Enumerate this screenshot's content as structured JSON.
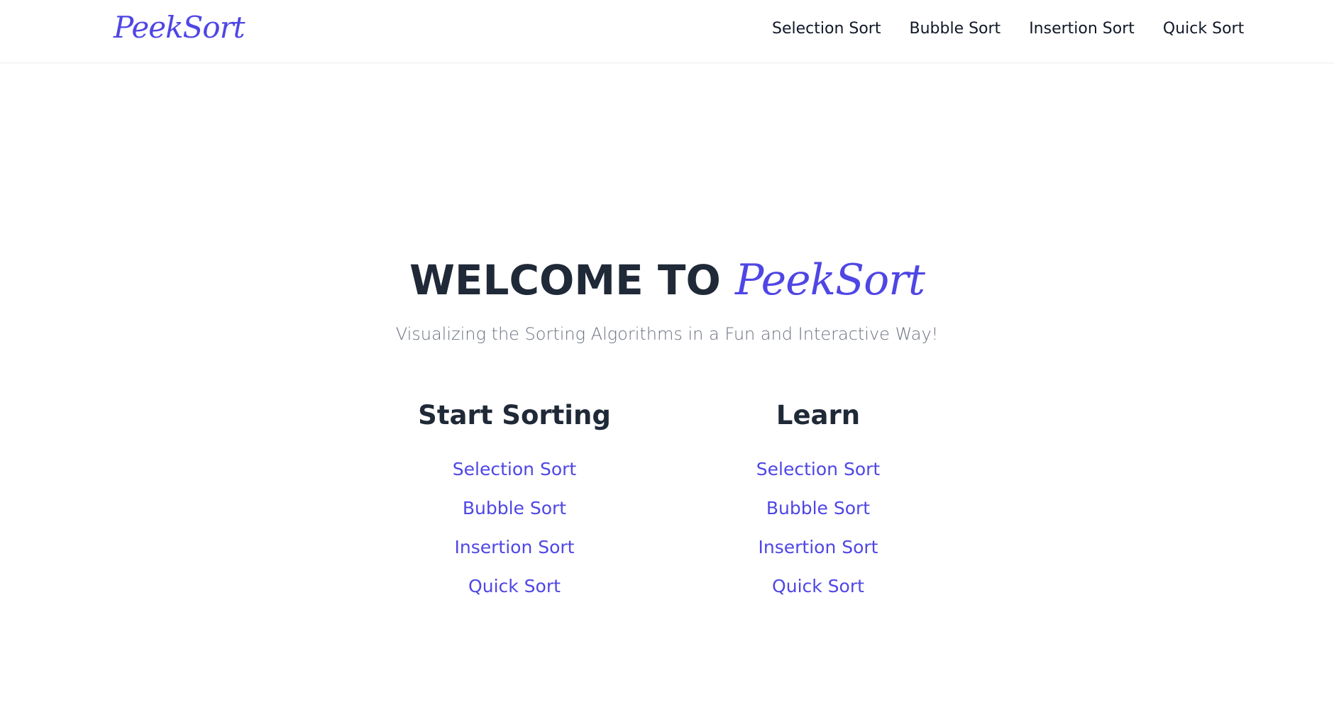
{
  "navbar": {
    "brand": "PeekSort",
    "links": [
      {
        "label": "Selection Sort"
      },
      {
        "label": "Bubble Sort"
      },
      {
        "label": "Insertion Sort"
      },
      {
        "label": "Quick Sort"
      }
    ]
  },
  "hero": {
    "title_prefix": "WELCOME TO",
    "title_brand": "PeekSort",
    "subtitle": "Visualizing the Sorting Algorithms in a Fun and Interactive Way!"
  },
  "sections": {
    "start": {
      "heading": "Start Sorting",
      "links": [
        {
          "label": "Selection Sort"
        },
        {
          "label": "Bubble Sort"
        },
        {
          "label": "Insertion Sort"
        },
        {
          "label": "Quick Sort"
        }
      ]
    },
    "learn": {
      "heading": "Learn",
      "links": [
        {
          "label": "Selection Sort"
        },
        {
          "label": "Bubble Sort"
        },
        {
          "label": "Insertion Sort"
        },
        {
          "label": "Quick Sort"
        }
      ]
    }
  },
  "colors": {
    "accent": "#4f46e5",
    "heading": "#1f2937",
    "muted": "#6b7280",
    "nav_text": "#111827"
  }
}
